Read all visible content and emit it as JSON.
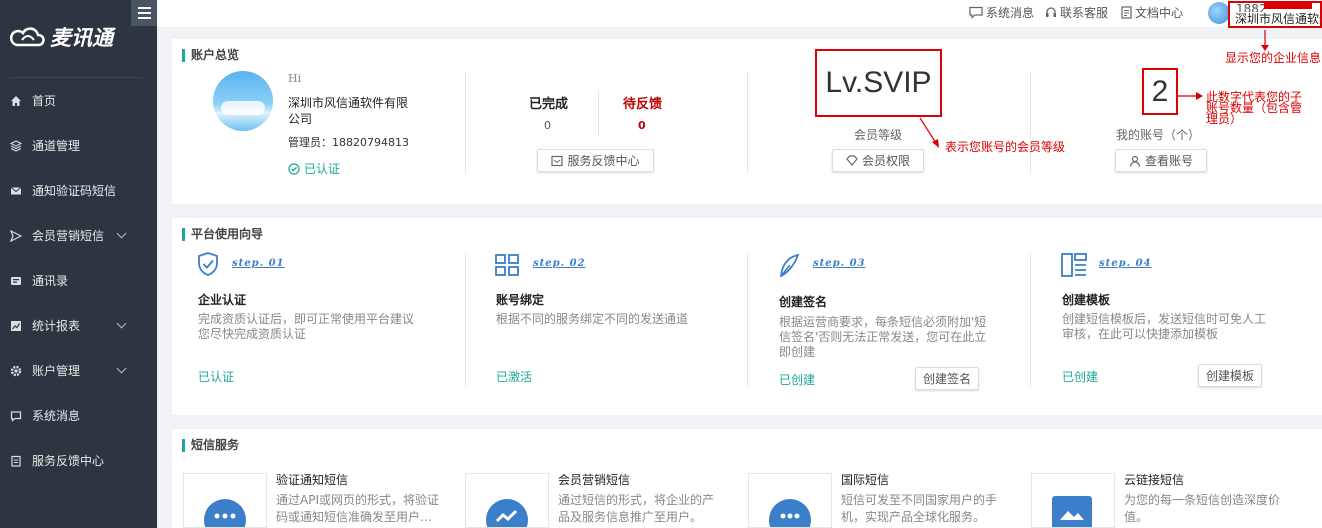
{
  "brand": {
    "name": "麦讯通"
  },
  "sidebar": {
    "items": [
      {
        "label": "首页",
        "icon": "home-icon"
      },
      {
        "label": "通道管理",
        "icon": "layers-icon"
      },
      {
        "label": "通知验证码短信",
        "icon": "mail-icon"
      },
      {
        "label": "会员营销短信",
        "icon": "send-icon"
      },
      {
        "label": "通讯录",
        "icon": "contact-card-icon"
      },
      {
        "label": "统计报表",
        "icon": "chart-icon"
      },
      {
        "label": "账户管理",
        "icon": "gear-icon"
      },
      {
        "label": "系统消息",
        "icon": "message-icon"
      },
      {
        "label": "服务反馈中心",
        "icon": "clipboard-icon"
      }
    ]
  },
  "topbar": {
    "messages": "系统消息",
    "support": "联系客服",
    "docs": "文档中心",
    "user_phone": "1882",
    "company": "深圳市风信通软件"
  },
  "account": {
    "title": "账户总览",
    "greeting": "Hi",
    "company": "深圳市风信通软件有限公司",
    "admin": "管理员：18820794813",
    "verified": "已认证",
    "completed_label": "已完成",
    "completed_value": "0",
    "pending_label": "待反馈",
    "pending_value": "0",
    "feedback_btn": "服务反馈中心",
    "level": "Lv.SVIP",
    "level_label": "会员等级",
    "rights_btn": "会员权限",
    "sub_count": "2",
    "my_accounts_label": "我的账号（个）",
    "view_btn": "查看账号"
  },
  "annotations": {
    "company": "显示您的企业信息",
    "level": "表示您账号的会员等级",
    "sub": "此数字代表您的子账号数量（包含管理员）"
  },
  "guide": {
    "title": "平台使用向导",
    "steps": [
      {
        "step": "step. 01",
        "name": "企业认证",
        "desc": "完成资质认证后，即可正常使用平台建议您尽快完成资质认证",
        "status": "已认证",
        "btn": ""
      },
      {
        "step": "step. 02",
        "name": "账号绑定",
        "desc": "根据不同的服务绑定不同的发送通道",
        "status": "已激活",
        "btn": ""
      },
      {
        "step": "step. 03",
        "name": "创建签名",
        "desc": "根据运营商要求，每条短信必须附加'短信签名'否则无法正常发送，您可在此立即创建",
        "status": "已创建",
        "btn": "创建签名"
      },
      {
        "step": "step. 04",
        "name": "创建模板",
        "desc": "创建短信模板后，发送短信时可免人工审核，在此可以快捷添加模板",
        "status": "已创建",
        "btn": "创建模板"
      }
    ]
  },
  "services": {
    "title": "短信服务",
    "items": [
      {
        "name": "验证通知短信",
        "desc": "通过API或网页的形式，将验证码或通知短信准确发至用户…"
      },
      {
        "name": "会员营销短信",
        "desc": "通过短信的形式，将企业的产品及服务信息推广至用户。"
      },
      {
        "name": "国际短信",
        "desc": "短信可发至不同国家用户的手机，实现产品全球化服务。"
      },
      {
        "name": "云链接短信",
        "desc": "为您的每一条短信创造深度价值。"
      }
    ]
  },
  "colors": {
    "sidebar": "#2d3640",
    "accent": "#1ba89a",
    "red": "#d00000",
    "pending": "#c00000"
  }
}
